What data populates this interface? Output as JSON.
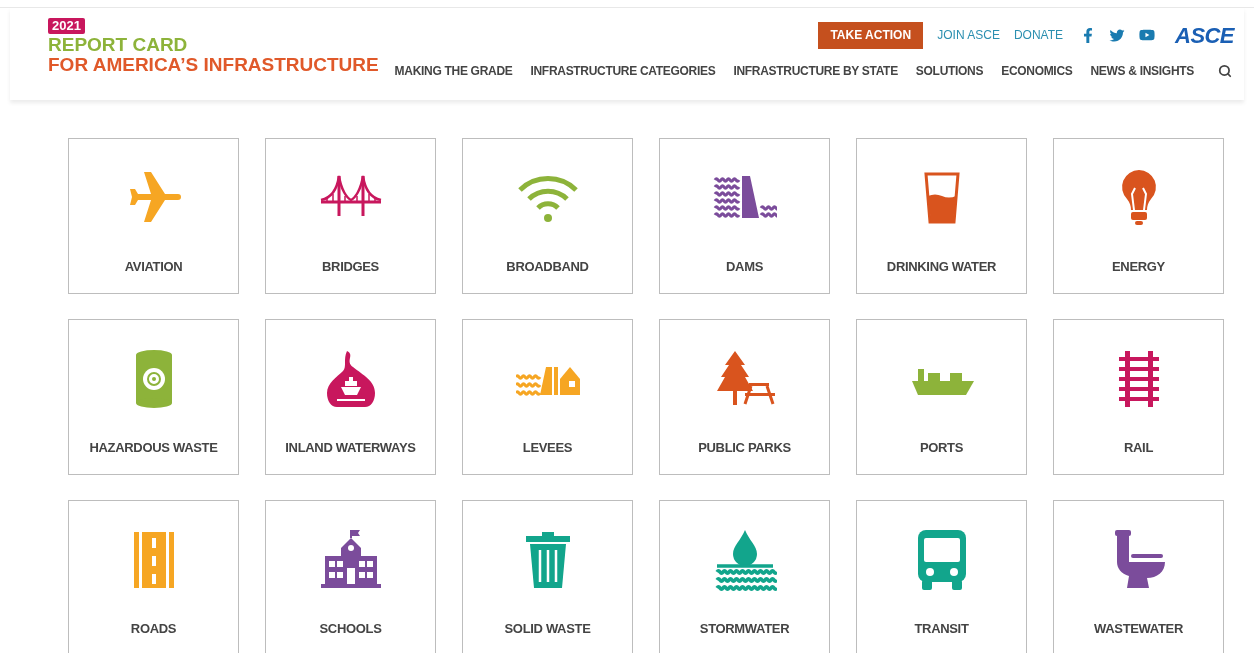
{
  "header": {
    "logo": {
      "year": "2021",
      "line_1": "REPORT CARD",
      "line_2": "FOR AMERICA’S INFRASTRUCTURE"
    },
    "utility": {
      "button": "TAKE ACTION",
      "links": [
        "JOIN ASCE",
        "DONATE"
      ],
      "brand": "ASCE"
    },
    "nav": [
      "MAKING THE GRADE",
      "INFRASTRUCTURE CATEGORIES",
      "INFRASTRUCTURE BY STATE",
      "SOLUTIONS",
      "ECONOMICS",
      "NEWS & INSIGHTS"
    ]
  },
  "categories": [
    {
      "label": "AVIATION",
      "kind": "plane",
      "color": "#f6a623"
    },
    {
      "label": "BRIDGES",
      "kind": "bridge",
      "color": "#c8175d"
    },
    {
      "label": "BROADBAND",
      "kind": "wifi",
      "color": "#8db33a"
    },
    {
      "label": "DAMS",
      "kind": "dam",
      "color": "#7b4c9b"
    },
    {
      "label": "DRINKING WATER",
      "kind": "glass",
      "color": "#d9541e"
    },
    {
      "label": "ENERGY",
      "kind": "bulb",
      "color": "#d9541e"
    },
    {
      "label": "HAZARDOUS WASTE",
      "kind": "barrel",
      "color": "#8db33a"
    },
    {
      "label": "INLAND WATERWAYS",
      "kind": "boat",
      "color": "#c8175d"
    },
    {
      "label": "LEVEES",
      "kind": "levee",
      "color": "#f6a623"
    },
    {
      "label": "PUBLIC PARKS",
      "kind": "park",
      "color": "#d9541e"
    },
    {
      "label": "PORTS",
      "kind": "ship",
      "color": "#8db33a"
    },
    {
      "label": "RAIL",
      "kind": "rail",
      "color": "#c8175d"
    },
    {
      "label": "ROADS",
      "kind": "road",
      "color": "#f6a623"
    },
    {
      "label": "SCHOOLS",
      "kind": "school",
      "color": "#7b4c9b"
    },
    {
      "label": "SOLID WASTE",
      "kind": "trash",
      "color": "#12a58c"
    },
    {
      "label": "STORMWATER",
      "kind": "drop",
      "color": "#12a58c"
    },
    {
      "label": "TRANSIT",
      "kind": "bus",
      "color": "#12a58c"
    },
    {
      "label": "WASTEWATER",
      "kind": "toilet",
      "color": "#7b4c9b"
    }
  ]
}
